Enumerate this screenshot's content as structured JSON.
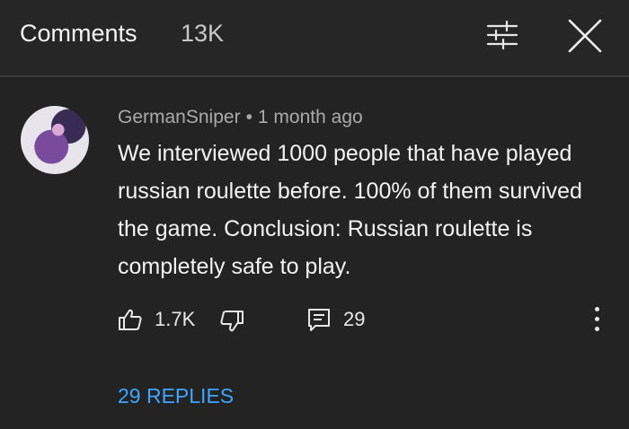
{
  "header": {
    "title": "Comments",
    "count": "13K",
    "icons": {
      "filter": "sort-filter-icon",
      "close": "close-icon"
    }
  },
  "comment": {
    "author": "GermanSniper",
    "separator": "•",
    "time": "1 month ago",
    "text": "We interviewed 1000 people that have played russian roulette before. 100% of them survived the game. Conclusion: Russian roulette is completely safe to play.",
    "likes": "1.7K",
    "replies_count": "29",
    "replies_link": "29 REPLIES"
  },
  "colors": {
    "background": "#232323",
    "link": "#3ea6ff",
    "text": "#f3f3f3",
    "muted": "#aaaaaa"
  }
}
